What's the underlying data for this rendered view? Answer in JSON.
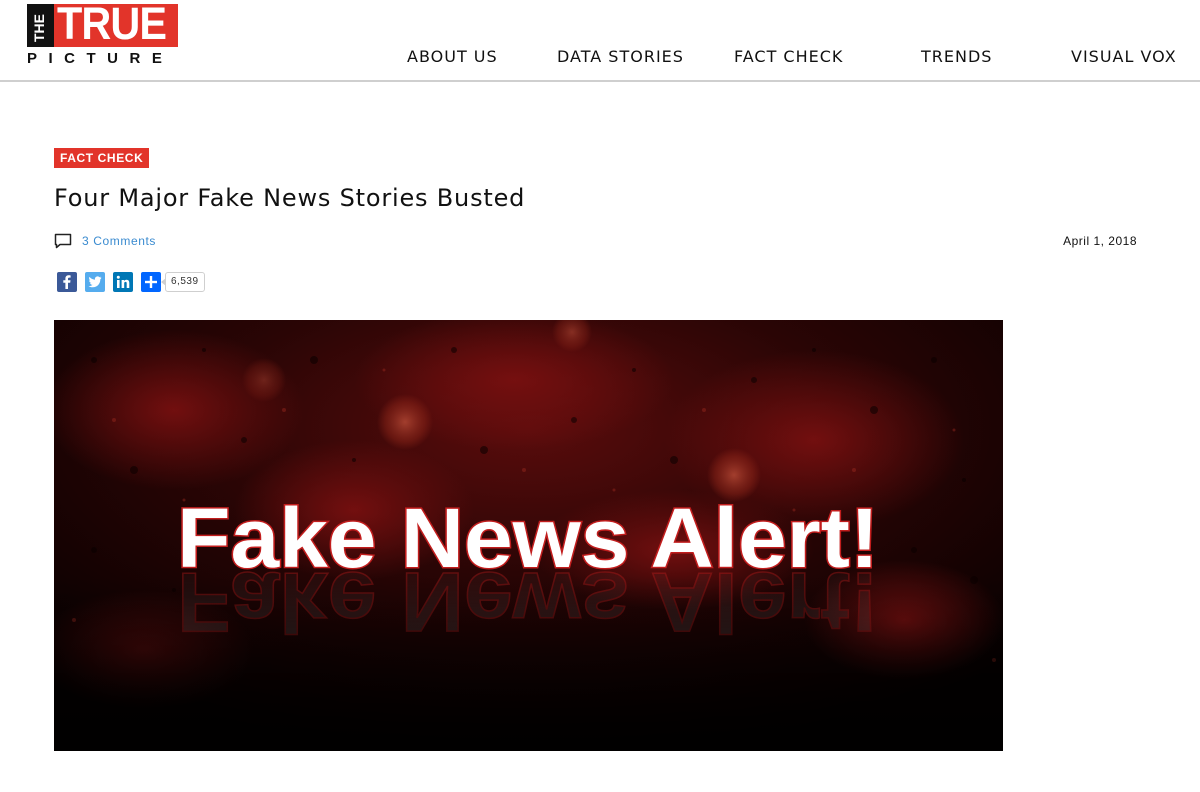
{
  "site": {
    "logo_the": "THE",
    "logo_true": "TRUE",
    "logo_picture": "PICTURE",
    "brand_red": "#e2342a"
  },
  "nav": {
    "items": [
      {
        "label": "ABOUT US"
      },
      {
        "label": "DATA STORIES"
      },
      {
        "label": "FACT CHECK"
      },
      {
        "label": "TRENDS"
      },
      {
        "label": "VISUAL VOX"
      }
    ]
  },
  "article": {
    "category": "FACT CHECK",
    "title": "Four Major Fake News Stories Busted",
    "comments": "3 Comments",
    "comment_icon": "comment-icon",
    "date": "April 1, 2018",
    "share": {
      "buttons": [
        {
          "icon": "facebook-icon",
          "color": "#3b5998"
        },
        {
          "icon": "twitter-icon",
          "color": "#55acee"
        },
        {
          "icon": "linkedin-icon",
          "color": "#0077b5"
        },
        {
          "icon": "add-share-icon",
          "color": "#0166ff"
        }
      ],
      "count": "6,539"
    },
    "hero": {
      "headline": "Fake News Alert!"
    }
  }
}
